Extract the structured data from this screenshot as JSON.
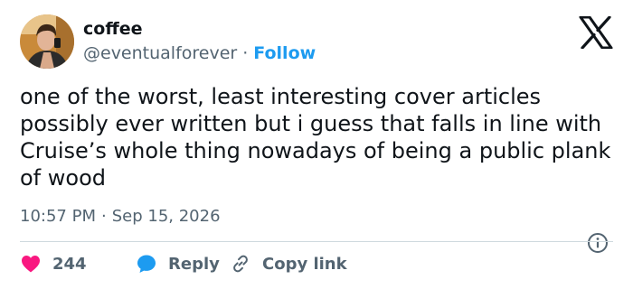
{
  "author": {
    "display_name": "coffee",
    "handle": "@eventualforever",
    "separator": "·",
    "follow_label": "Follow"
  },
  "tweet": {
    "text": "one of the worst, least interesting cover articles possibly ever written but i guess that falls in line with Cruise’s whole thing nowadays of being a public plank of wood"
  },
  "meta": {
    "time": "10:57 PM",
    "separator": "·",
    "date": "Sep 15, 2026"
  },
  "actions": {
    "like_count": "244",
    "reply_label": "Reply",
    "copy_link_label": "Copy link"
  },
  "icons": {
    "brand": "x-logo-icon",
    "info": "info-icon",
    "like": "heart-icon",
    "reply": "speech-bubble-icon",
    "copy": "link-icon"
  },
  "colors": {
    "text": "#0f1419",
    "secondary": "#536471",
    "accent": "#1d9bf0",
    "like": "#f91880",
    "divider": "#cfd9de"
  }
}
